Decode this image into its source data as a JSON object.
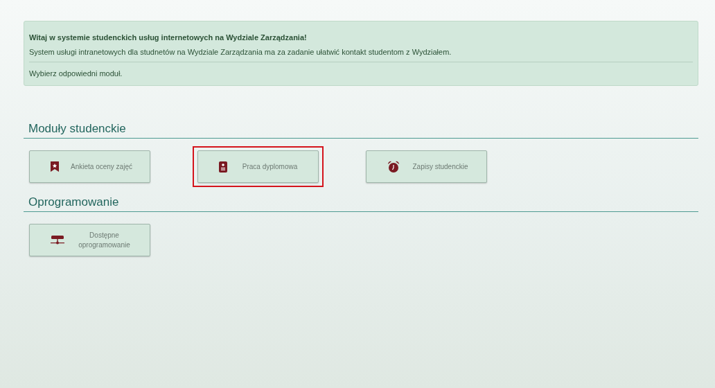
{
  "welcome": {
    "title": "Witaj w systemie studenckich usług internetowych na Wydziale Zarządzania!",
    "text": "System usługi intranetowych dla studnetów na Wydziale Zarządzania ma za zadanie ułatwić kontakt studentom z Wydziałem.",
    "hint": "Wybierz odpowiedni moduł."
  },
  "sections": [
    {
      "title": "Moduły studenckie",
      "modules": [
        {
          "label": "Ankieta oceny zajęć",
          "kind": "bookmark",
          "highlighted": false
        },
        {
          "label": "Praca dyplomowa",
          "kind": "document",
          "highlighted": true
        },
        {
          "label": "Zapisy studenckie",
          "kind": "alarm",
          "highlighted": false
        }
      ]
    },
    {
      "title": "Oprogramowanie",
      "modules": [
        {
          "label": "Dostępne oprogramowanie",
          "kind": "network",
          "highlighted": false
        }
      ]
    }
  ]
}
